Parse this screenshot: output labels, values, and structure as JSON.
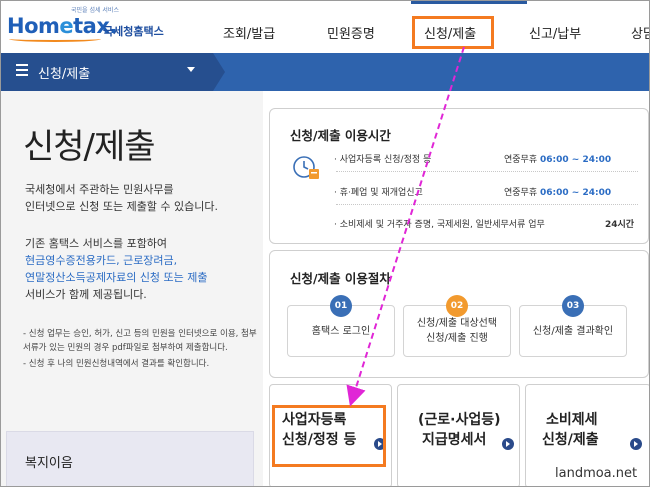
{
  "header": {
    "logo": {
      "tagline": "국민을 섬세 서비스",
      "word_a": "Hom",
      "word_e": "e",
      "word_b": "tax.",
      "korean": "국세청홈택스"
    },
    "nav": [
      "조회/발급",
      "민원증명",
      "신청/제출",
      "신고/납부",
      "상담"
    ]
  },
  "breadcrumb": {
    "title": "신청/제출"
  },
  "left": {
    "page_title": "신청/제출",
    "intro_lines": [
      "국세청에서 주관하는 민원사무를",
      "인터넷으로 신청 또는 제출할 수 있습니다."
    ],
    "intro2_line1": "기존 홈택스 서비스를 포함하여",
    "intro2_link1": "현금영수증전용카드, 근로장려금,",
    "intro2_link2": "연말정산소득공제자료의 신청 또는 제출",
    "intro2_line4": "서비스가 함께 제공됩니다.",
    "notes": [
      "- 신청 업무는 승인, 허가, 신고 등의 민원을 인터넷으로 이용, 첨부서류가 있는 민원의 경우 pdf파일로 첨부하여 제출합니다.",
      "- 신청 후 나의 민원신청내역에서 결과를 확인합니다."
    ],
    "welfare": "복지이음"
  },
  "hours": {
    "title": "신청/제출 이용시간",
    "rows": [
      {
        "label": "· 사업자등록 신청/정정 등",
        "days": "연중무휴",
        "time": "06:00 ~ 24:00"
      },
      {
        "label": "· 휴·폐업 및 재개업신고",
        "days": "연중무휴",
        "time": "06:00 ~ 24:00"
      },
      {
        "label": "· 소비제세 및 거주자 증명, 국제세원, 일반세무서류 업무",
        "days": "",
        "time": "24시간"
      }
    ]
  },
  "steps": {
    "title": "신청/제출 이용절차",
    "items": [
      {
        "num": "01",
        "label1": "홈택스 로그인",
        "label2": "",
        "color": "#3a6fb6"
      },
      {
        "num": "02",
        "label1": "신청/제출 대상선택",
        "label2": "신청/제출 진행",
        "color": "#f29a2e"
      },
      {
        "num": "03",
        "label1": "신청/제출 결과확인",
        "label2": "",
        "color": "#3a6fb6"
      }
    ]
  },
  "cards": [
    {
      "line1": "사업자등록",
      "line2": "신청/정정 등"
    },
    {
      "line1": "(근로·사업등)",
      "line2": "지급명세서"
    },
    {
      "line1": "소비제세",
      "line2": "신청/제출"
    }
  ],
  "watermark": "landmoa.net"
}
